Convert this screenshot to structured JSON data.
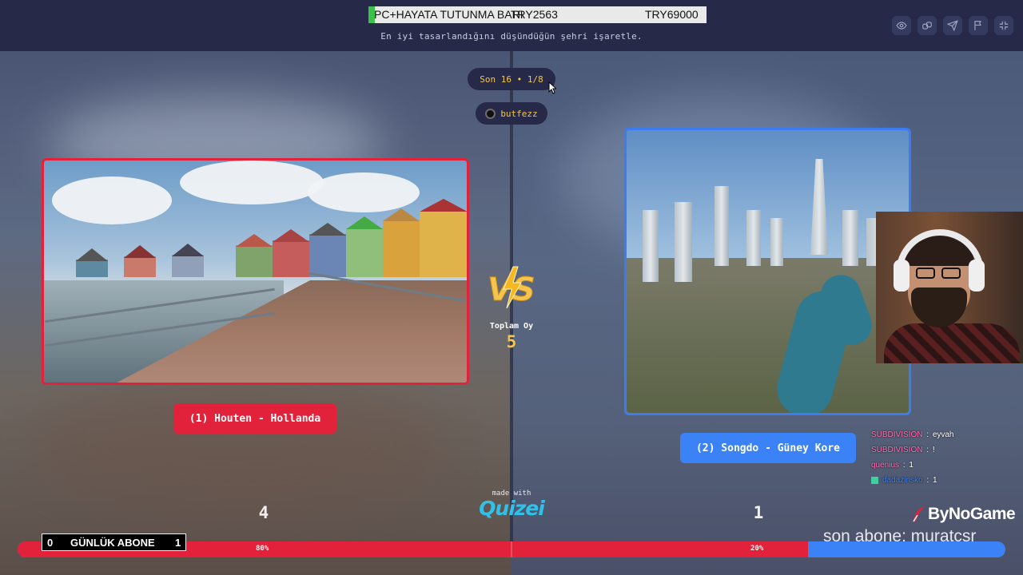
{
  "header": {
    "subtitle": "En iyi tasarlandığını düşündüğün şehri işaretle.",
    "tools": [
      "eye-icon",
      "link-icon",
      "send-icon",
      "flag-icon",
      "collapse-icon"
    ]
  },
  "ticker": {
    "item1": "PC+HAYATA TUTUNMA BARI",
    "item2": "TRY2563",
    "item3": "TRY69000"
  },
  "round": {
    "label": "Son 16 • 1/8"
  },
  "user": {
    "name": "butfezz"
  },
  "match": {
    "left": {
      "label": "(1) Houten - Hollanda",
      "votes": "4",
      "percent_label": "80%",
      "percent": 0.8
    },
    "right": {
      "label": "(2) Songdo - Güney Kore",
      "votes": "1",
      "percent_label": "20%",
      "percent": 0.2
    },
    "total_label": "Toplam Oy",
    "total_value": "5"
  },
  "chat": [
    {
      "name": "SUBDIVISION",
      "message": "eyvah"
    },
    {
      "name": "SUBDIVISION",
      "message": "!"
    },
    {
      "name": "quenius",
      "message": "1"
    },
    {
      "name": "dadazinsko",
      "message": "1"
    }
  ],
  "footer": {
    "made_with": "made with",
    "brand": "Quizei",
    "channel_logo": "ByNoGame",
    "last_sub": "son abone: muratcsr",
    "daily_sub_label": "GÜNLÜK ABONE",
    "daily_sub_left": "0",
    "daily_sub_right": "1"
  },
  "colors": {
    "left": "#e2223a",
    "right": "#3b82f6",
    "accent": "#f3c550"
  }
}
